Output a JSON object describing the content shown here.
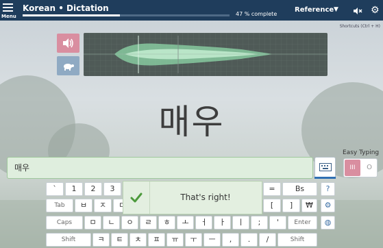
{
  "header": {
    "menu_label": "Menu",
    "course_title": "Korean • Dictation",
    "progress_percent": 47,
    "progress_text": "47 % complete",
    "reference_label": "Reference",
    "icons": [
      "menu-icon",
      "chevron-down-icon",
      "mute-icon",
      "gear-icon"
    ]
  },
  "shortcuts_label": "Shortcuts (Ctrl + H)",
  "prompt": {
    "word": "매우"
  },
  "answer": {
    "value": "매우"
  },
  "easy_typing": {
    "label": "Easy Typing",
    "on_label": "III",
    "off_label": "O"
  },
  "feedback": {
    "message": "That's right!"
  },
  "keyboard": {
    "row1": [
      "`",
      "1",
      "2",
      "3",
      "=",
      "Bs"
    ],
    "row2": [
      "Tab",
      "ㅂ",
      "ㅈ",
      "ㄷ",
      "[",
      "]",
      "₩"
    ],
    "row3": [
      "Caps",
      "ㅁ",
      "ㄴ",
      "ㅇ",
      "ㄹ",
      "ㅎ",
      "ㅗ",
      "ㅓ",
      "ㅏ",
      "ㅣ",
      ";",
      "'",
      "Enter"
    ],
    "row4": [
      "Shift",
      "ㅋ",
      "ㅌ",
      "ㅊ",
      "ㅍ",
      "ㅠ",
      "ㅜ",
      "ㅡ",
      ",",
      ".",
      "/",
      "Shift"
    ]
  },
  "colors": {
    "topbar": "#1f3d5c",
    "accent_pink": "#d98ea0",
    "accent_blue": "#8faac3",
    "success_bg": "#e3efe0"
  }
}
